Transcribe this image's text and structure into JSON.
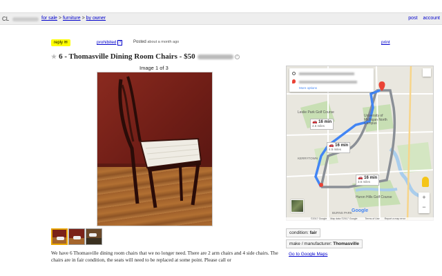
{
  "header": {
    "brand": "CL",
    "breadcrumb": [
      "for sale",
      "furniture",
      "by owner"
    ],
    "separator": ">",
    "links": [
      "post",
      "account"
    ]
  },
  "actions": {
    "reply_label": "reply",
    "reply_icon": "envelope-icon",
    "prohibited_label": "prohibited",
    "posted_label": "Posted",
    "posted_time": "about a month ago",
    "print_label": "print"
  },
  "listing": {
    "title": "6 - Thomasville Dining Room Chairs - $50",
    "image_label": "Image",
    "image_index": "1",
    "image_of": "of",
    "image_total": "3",
    "description": "We have 6 Thomasville dining room chairs that we no longer need. There are 2 arm chairs and 4 side chairs. The chairs are in fair condition, the seats will need to be replaced at some point. Please call or"
  },
  "thumbnails": [
    {
      "selected": true
    },
    {
      "selected": false
    },
    {
      "selected": false
    }
  ],
  "map": {
    "routes": [
      {
        "time": "16 min",
        "distance": "4.6 miles"
      },
      {
        "time": "16 min",
        "distance": "4.5 miles"
      },
      {
        "time": "16 min",
        "distance": "3.6 miles"
      }
    ],
    "places": [
      "Leslie Park Golf Course",
      "University of Michigan North Campus",
      "KERRYTOWN",
      "Huron Hills Golf Course",
      "BURNS PARK"
    ],
    "more_options": "More options",
    "attribution": [
      "©2017 Google",
      "Map data ©2017 Google",
      "Terms of Use",
      "Report a map error"
    ],
    "google_logo": "Google",
    "zoom_in": "+",
    "zoom_out": "−",
    "route_color": "#1a73e8"
  },
  "attributes": {
    "condition_label": "condition:",
    "condition_value": "fair",
    "make_label": "make / manufacturer:",
    "make_value": "Thomasville"
  },
  "google_maps_link": "Go to Google Maps"
}
